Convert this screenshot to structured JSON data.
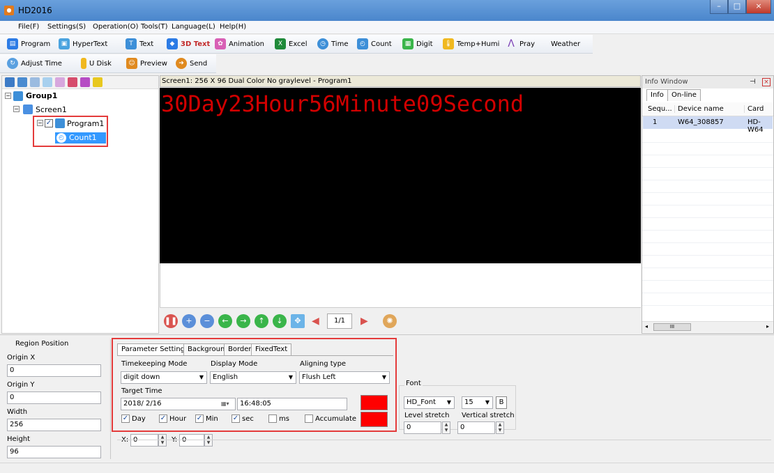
{
  "window": {
    "title": "HD2016",
    "minimize": "–",
    "maximize": "□",
    "close": "×"
  },
  "menu": [
    "File(F)",
    "Settings(S)",
    "Operation(O)",
    "Tools(T)",
    "Language(L)",
    "Help(H)"
  ],
  "toolbar1": [
    {
      "label": "Program",
      "icon": "program-icon",
      "color": "#2c7be5"
    },
    {
      "label": "HyperText",
      "icon": "hypertext-icon",
      "color": "#4aa3df"
    },
    {
      "label": "Text",
      "icon": "text-icon",
      "color": "#3d8fd8"
    },
    {
      "label": "3D Text",
      "icon": "3d-text-icon",
      "color": "#c22a2a"
    },
    {
      "label": "Animation",
      "icon": "animation-icon",
      "color": "#d85fb5"
    },
    {
      "label": "Excel",
      "icon": "excel-icon",
      "color": "#1f8a3a"
    },
    {
      "label": "Time",
      "icon": "time-icon",
      "color": "#3d8fd8"
    },
    {
      "label": "Count",
      "icon": "count-icon",
      "color": "#3d8fd8"
    },
    {
      "label": "Digit",
      "icon": "digit-icon",
      "color": "#3ab54a"
    },
    {
      "label": "Temp+Humi",
      "icon": "temp-humi-icon",
      "color": "#f0b81f"
    },
    {
      "label": "Pray",
      "icon": "pray-icon",
      "color": "#7b3fb5"
    },
    {
      "label": "Weather",
      "icon": "",
      "color": ""
    }
  ],
  "toolbar2": [
    {
      "label": "Adjust Time",
      "icon": "adjust-time-icon",
      "color": "#5aa0e0"
    },
    {
      "label": "U Disk",
      "icon": "u-disk-icon",
      "color": "#f0b81f"
    },
    {
      "label": "Preview",
      "icon": "preview-icon",
      "color": "#e08a1f"
    },
    {
      "label": "Send",
      "icon": "send-icon",
      "color": "#e08a1f"
    }
  ],
  "tree": {
    "group": "Group1",
    "screen": "Screen1",
    "program": "Program1",
    "count": "Count1"
  },
  "preview": {
    "header": "Screen1: 256 X 96  Dual Color No graylevel - Program1",
    "led_text": "30Day23Hour56Minute09Second",
    "page": "1/1"
  },
  "info_window": {
    "title": "Info Window",
    "tabs": [
      "Info",
      "On-line"
    ],
    "columns": [
      "Sequ...",
      "Device name",
      "Card"
    ],
    "rows": [
      {
        "seq": "1",
        "device": "W64_308857",
        "card": "HD-W64"
      }
    ],
    "scroll_thumb": "III"
  },
  "region": {
    "title": "Region Position",
    "origin_x_label": "Origin X",
    "origin_x": "0",
    "origin_y_label": "Origin Y",
    "origin_y": "0",
    "width_label": "Width",
    "width": "256",
    "height_label": "Height",
    "height": "96"
  },
  "params": {
    "tabs": [
      "Parameter Settings",
      "Background",
      "Border",
      "FixedText"
    ],
    "timekeeping_label": "Timekeeping Mode",
    "timekeeping_value": "digit down",
    "display_label": "Display Mode",
    "display_value": "English",
    "align_label": "Aligning type",
    "align_value": "Flush Left",
    "target_label": "Target Time",
    "date_value": "2018/ 2/16",
    "time_value": "16:48:05",
    "checks": [
      {
        "label": "Day",
        "checked": true
      },
      {
        "label": "Hour",
        "checked": true
      },
      {
        "label": "Min",
        "checked": true
      },
      {
        "label": "sec",
        "checked": true
      },
      {
        "label": "ms",
        "checked": false
      },
      {
        "label": "Accumulate",
        "checked": false
      }
    ],
    "x_label": "X:",
    "x_value": "0",
    "y_label": "Y:",
    "y_value": "0",
    "color1": "#ff0000",
    "color2": "#ff0000"
  },
  "font": {
    "title": "Font",
    "font_value": "HD_Font",
    "size_value": "15",
    "bold_label": "B",
    "level_stretch_label": "Level stretch",
    "level_stretch": "0",
    "vertical_stretch_label": "Vertical stretch",
    "vertical_stretch": "0"
  }
}
